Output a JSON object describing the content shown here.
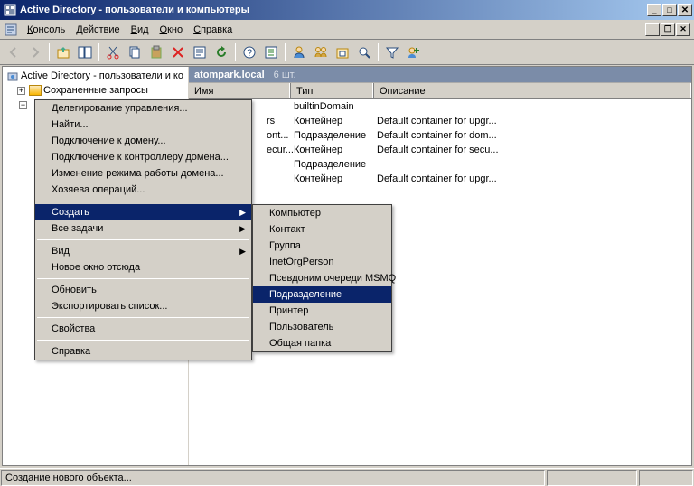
{
  "window": {
    "title": "Active Directory - пользователи и компьютеры"
  },
  "menubar": {
    "items": [
      "Консоль",
      "Действие",
      "Вид",
      "Окно",
      "Справка"
    ],
    "app_icon": "ad-icon"
  },
  "tree": {
    "root": "Active Directory - пользователи и ко",
    "items": [
      "Сохраненные запросы"
    ]
  },
  "address": {
    "path": "atompark.local",
    "count": "6 шт."
  },
  "columns": {
    "c1": "Имя",
    "c2": "Тип",
    "c3": "Описание"
  },
  "rows": [
    {
      "name": "",
      "type": "builtinDomain",
      "desc": ""
    },
    {
      "name": "rs",
      "type": "Контейнер",
      "desc": "Default container for upgr..."
    },
    {
      "name": "ont...",
      "type": "Подразделение",
      "desc": "Default container for dom..."
    },
    {
      "name": "ecur...",
      "type": "Контейнер",
      "desc": "Default container for secu..."
    },
    {
      "name": "",
      "type": "Подразделение",
      "desc": ""
    },
    {
      "name": "",
      "type": "Контейнер",
      "desc": "Default container for upgr..."
    }
  ],
  "context_menu": [
    {
      "label": "Делегирование управления..."
    },
    {
      "label": "Найти..."
    },
    {
      "label": "Подключение к домену..."
    },
    {
      "label": "Подключение к контроллеру домена..."
    },
    {
      "label": "Изменение режима работы домена..."
    },
    {
      "label": "Хозяева операций..."
    },
    {
      "sep": true
    },
    {
      "label": "Создать",
      "submenu": true,
      "highlight": true
    },
    {
      "label": "Все задачи",
      "submenu": true
    },
    {
      "sep": true
    },
    {
      "label": "Вид",
      "submenu": true
    },
    {
      "label": "Новое окно отсюда"
    },
    {
      "sep": true
    },
    {
      "label": "Обновить"
    },
    {
      "label": "Экспортировать список..."
    },
    {
      "sep": true
    },
    {
      "label": "Свойства"
    },
    {
      "sep": true
    },
    {
      "label": "Справка"
    }
  ],
  "submenu": [
    {
      "label": "Компьютер"
    },
    {
      "label": "Контакт"
    },
    {
      "label": "Группа"
    },
    {
      "label": "InetOrgPerson"
    },
    {
      "label": "Псевдоним очереди MSMQ"
    },
    {
      "label": "Подразделение",
      "highlight": true
    },
    {
      "label": "Принтер"
    },
    {
      "label": "Пользователь"
    },
    {
      "label": "Общая папка"
    }
  ],
  "status": {
    "text": "Создание нового объекта..."
  },
  "colors": {
    "highlight": "#0a246a",
    "bg": "#d4d0c8"
  }
}
